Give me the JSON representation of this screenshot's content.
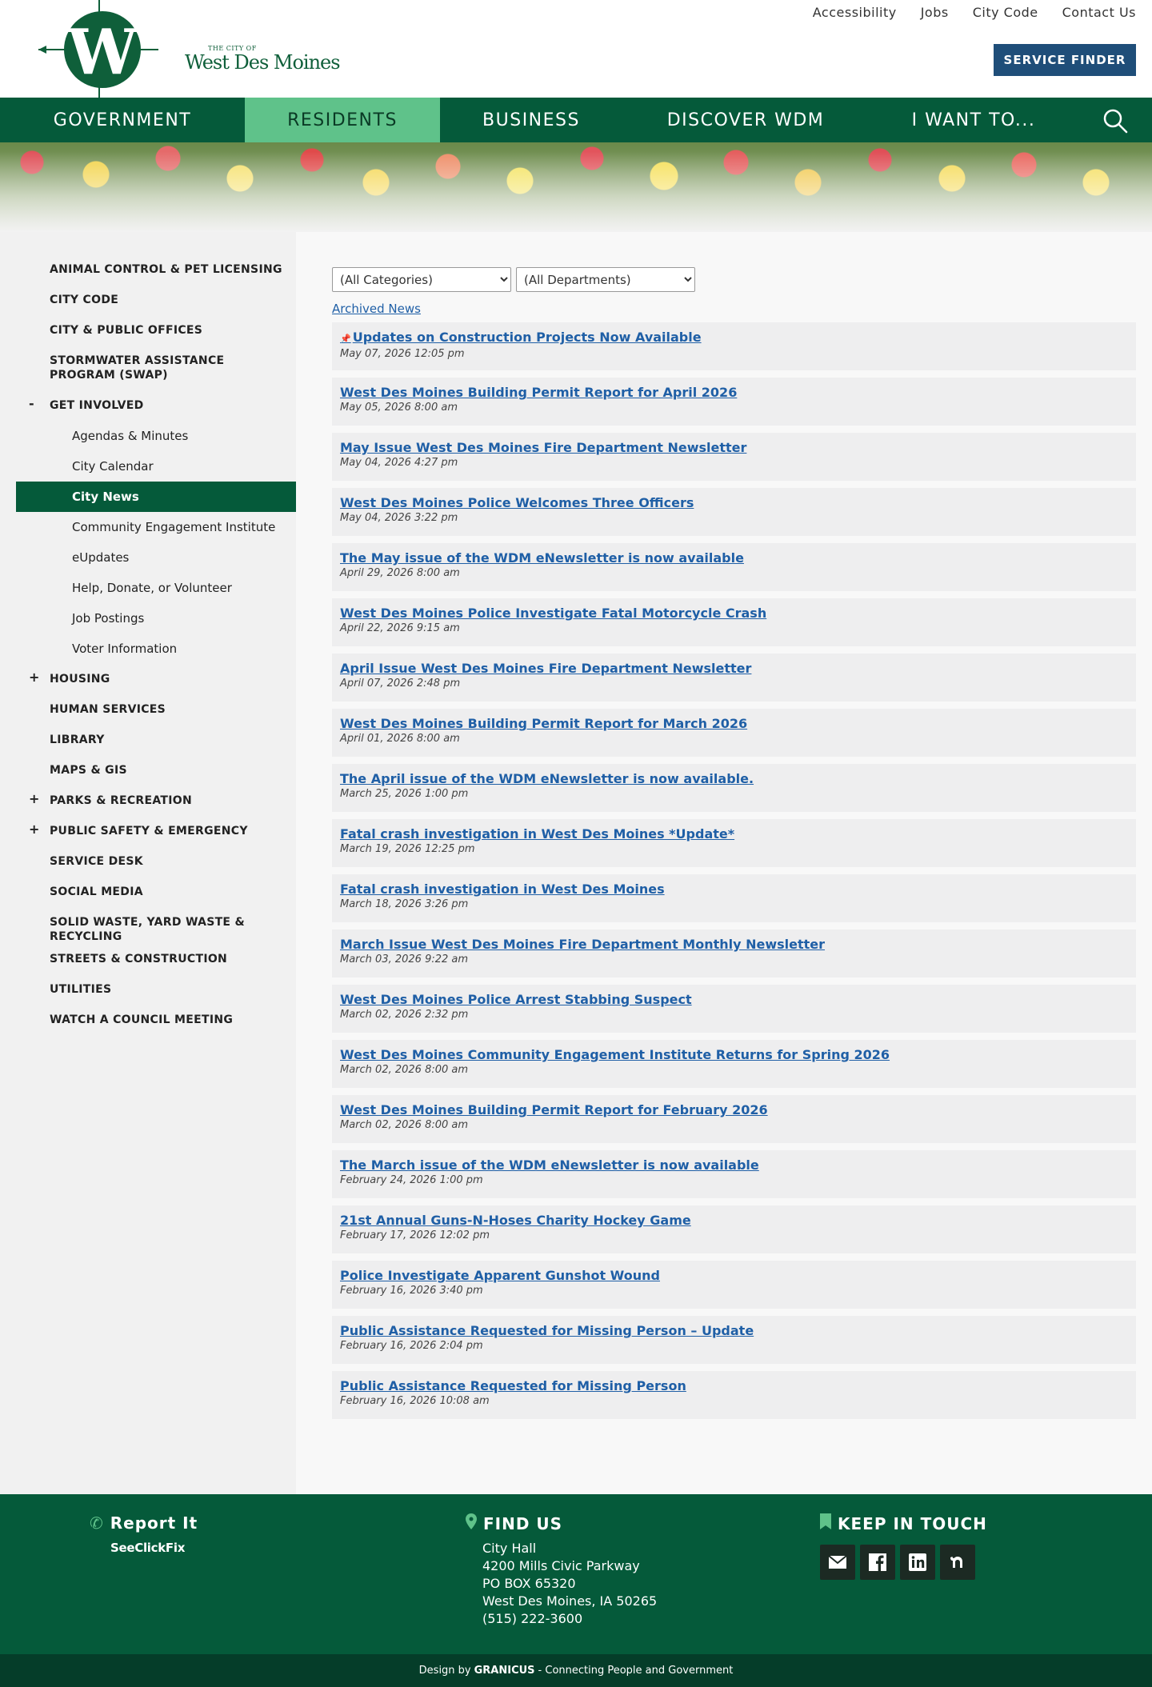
{
  "header": {
    "logo_small": "THE CITY OF",
    "logo_name": "West Des Moines",
    "util_links": [
      "Accessibility",
      "Jobs",
      "City Code",
      "Contact Us"
    ],
    "service_finder": "SERVICE FINDER"
  },
  "mainnav": {
    "items": [
      "GOVERNMENT",
      "RESIDENTS",
      "BUSINESS",
      "DISCOVER WDM",
      "I WANT TO..."
    ],
    "active": "RESIDENTS"
  },
  "sidebar": {
    "items": [
      {
        "label": "ANIMAL CONTROL & PET LICENSING",
        "toggle": ""
      },
      {
        "label": "CITY CODE",
        "toggle": ""
      },
      {
        "label": "CITY & PUBLIC OFFICES",
        "toggle": ""
      },
      {
        "label": "STORMWATER ASSISTANCE PROGRAM (SWAP)",
        "toggle": ""
      },
      {
        "label": "GET INVOLVED",
        "toggle": "-"
      }
    ],
    "sub_items": [
      "Agendas & Minutes",
      "City Calendar",
      "City News",
      "Community Engagement Institute",
      "eUpdates",
      "Help, Donate, or Volunteer",
      "Job Postings",
      "Voter Information"
    ],
    "active_sub": "City News",
    "items_after": [
      {
        "label": "HOUSING",
        "toggle": "+"
      },
      {
        "label": "HUMAN SERVICES",
        "toggle": ""
      },
      {
        "label": "LIBRARY",
        "toggle": ""
      },
      {
        "label": "MAPS & GIS",
        "toggle": ""
      },
      {
        "label": "PARKS & RECREATION",
        "toggle": "+"
      },
      {
        "label": "PUBLIC SAFETY & EMERGENCY",
        "toggle": "+"
      },
      {
        "label": "SERVICE DESK",
        "toggle": ""
      },
      {
        "label": "SOCIAL MEDIA",
        "toggle": ""
      },
      {
        "label": "SOLID WASTE, YARD WASTE & RECYCLING",
        "toggle": ""
      },
      {
        "label": "STREETS & CONSTRUCTION",
        "toggle": ""
      },
      {
        "label": "UTILITIES",
        "toggle": ""
      },
      {
        "label": "WATCH A COUNCIL MEETING",
        "toggle": ""
      }
    ]
  },
  "filters": {
    "categories": "(All Categories)",
    "departments": "(All Departments)"
  },
  "archived_link": "Archived News",
  "news": [
    {
      "title": "Updates on Construction Projects Now Available",
      "date": "May 07, 2026 12:05 pm",
      "pinned": true
    },
    {
      "title": "West Des Moines Building Permit Report for April 2026",
      "date": "May 05, 2026 8:00 am"
    },
    {
      "title": "May Issue West Des Moines Fire Department Newsletter",
      "date": "May 04, 2026 4:27 pm"
    },
    {
      "title": "West Des Moines Police Welcomes Three Officers",
      "date": "May 04, 2026 3:22 pm"
    },
    {
      "title": "The May issue of the WDM eNewsletter is now available",
      "date": "April 29, 2026 8:00 am"
    },
    {
      "title": "West Des Moines Police Investigate Fatal Motorcycle Crash",
      "date": "April 22, 2026 9:15 am"
    },
    {
      "title": "April Issue West Des Moines Fire Department Newsletter",
      "date": "April 07, 2026 2:48 pm"
    },
    {
      "title": "West Des Moines Building Permit Report for March 2026",
      "date": "April 01, 2026 8:00 am"
    },
    {
      "title": "The April issue of the WDM eNewsletter is now available.",
      "date": "March 25, 2026 1:00 pm"
    },
    {
      "title": "Fatal crash investigation in West Des Moines *Update*",
      "date": "March 19, 2026 12:25 pm"
    },
    {
      "title": "Fatal crash investigation in West Des Moines",
      "date": "March 18, 2026 3:26 pm"
    },
    {
      "title": "March Issue West Des Moines Fire Department Monthly Newsletter",
      "date": "March 03, 2026 9:22 am"
    },
    {
      "title": "West Des Moines Police Arrest Stabbing Suspect",
      "date": "March 02, 2026 2:32 pm"
    },
    {
      "title": "West Des Moines Community Engagement Institute Returns for Spring 2026",
      "date": "March 02, 2026 8:00 am"
    },
    {
      "title": "West Des Moines Building Permit Report for February 2026",
      "date": "March 02, 2026 8:00 am"
    },
    {
      "title": "The March issue of the WDM eNewsletter is now available",
      "date": "February 24, 2026 1:00 pm"
    },
    {
      "title": "21st Annual Guns-N-Hoses Charity Hockey Game",
      "date": "February 17, 2026 12:02 pm"
    },
    {
      "title": "Police Investigate Apparent Gunshot Wound",
      "date": "February 16, 2026 3:40 pm"
    },
    {
      "title": "Public Assistance Requested for Missing Person – Update",
      "date": "February 16, 2026 2:04 pm"
    },
    {
      "title": "Public Assistance Requested for Missing Person",
      "date": "February 16, 2026 10:08 am"
    }
  ],
  "footer": {
    "report_heading": "Report It",
    "seeclickfix": "SeeClickFix",
    "find_heading": "FIND US",
    "address": [
      "City Hall",
      "4200 Mills Civic Parkway",
      "PO BOX 65320",
      "West Des Moines, IA 50265",
      "(515) 222-3600"
    ],
    "keep_heading": "KEEP IN TOUCH",
    "social": [
      "email-icon",
      "facebook-icon",
      "linkedin-icon",
      "nextdoor-icon"
    ]
  },
  "bottom_bar": {
    "prefix": "Design by",
    "brand": "GRANICUS",
    "suffix": "- Connecting People and Government"
  },
  "colors": {
    "primary_green": "#055a3a",
    "active_green": "#5fc28a",
    "link_blue": "#1f5fa6",
    "service_blue": "#1f4e79"
  }
}
